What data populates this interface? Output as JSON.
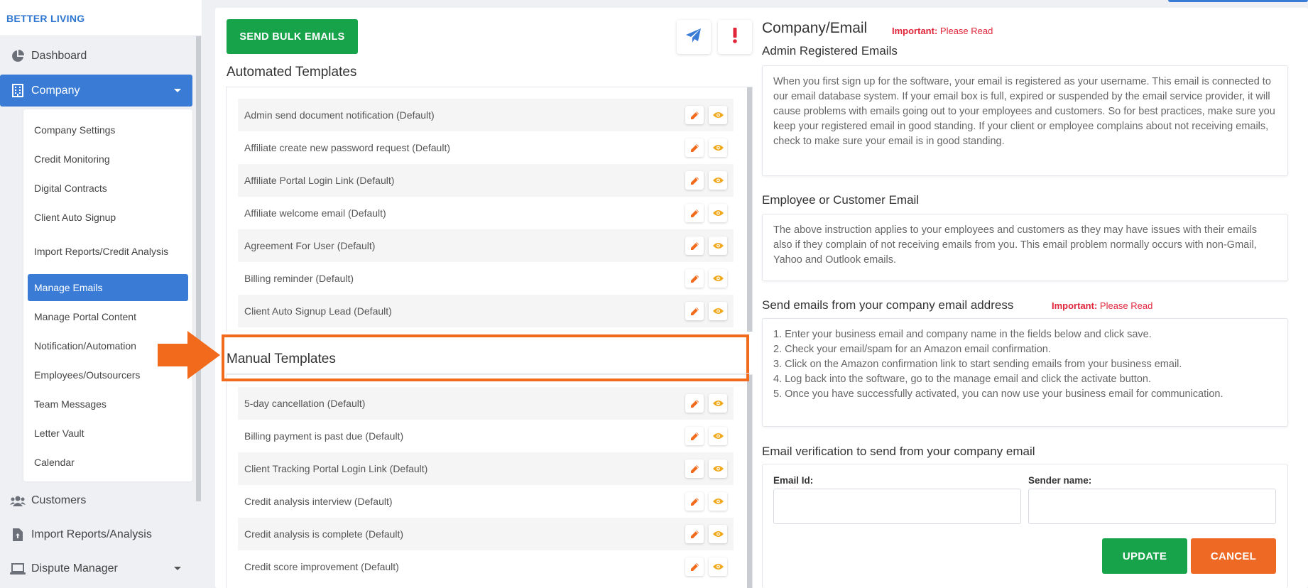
{
  "brand": {
    "name": "BETTER LIVING"
  },
  "sidebar": {
    "items": [
      {
        "label": "Dashboard",
        "icon": "pie-chart-icon"
      },
      {
        "label": "Company",
        "icon": "building-icon"
      },
      {
        "label": "Customers",
        "icon": "users-icon"
      },
      {
        "label": "Import Reports/Analysis",
        "icon": "file-upload-icon"
      },
      {
        "label": "Dispute Manager",
        "icon": "laptop-icon"
      }
    ],
    "company_submenu": [
      "Company Settings",
      "Credit Monitoring",
      "Digital Contracts",
      "Client Auto Signup",
      "Import Reports/Credit Analysis",
      "Manage Emails",
      "Manage Portal Content",
      "Notification/Automation",
      "Employees/Outsourcers",
      "Team Messages",
      "Letter Vault",
      "Calendar"
    ],
    "active_submenu": "Manage Emails"
  },
  "toolbar": {
    "bulk_label": "SEND BULK EMAILS",
    "send_icon": "paper-plane-icon",
    "alert_icon": "exclamation-icon"
  },
  "templates": {
    "automated_title": "Automated Templates",
    "automated": [
      "Admin send document notification (Default)",
      "Affiliate create new password request (Default)",
      "Affiliate Portal Login Link (Default)",
      "Affiliate welcome email (Default)",
      "Agreement For User (Default)",
      "Billing reminder (Default)",
      "Client Auto Signup Lead (Default)"
    ],
    "manual_title": "Manual Templates",
    "manual": [
      "5-day cancellation (Default)",
      "Billing payment is past due (Default)",
      "Client Tracking Portal Login Link (Default)",
      "Credit analysis interview (Default)",
      "Credit analysis is complete (Default)",
      "Credit score improvement (Default)"
    ]
  },
  "right": {
    "title": "Company/Email",
    "important_label": "Important:",
    "please_read": "Please Read",
    "admin_title": "Admin Registered Emails",
    "admin_text": "When you first sign up for the software, your email is registered as your username. This email is connected to our email database system. If your email box is full, expired or suspended by the email service provider, it will cause problems with emails going out to your employees and customers. So for best practices, make sure you keep your registered email in good standing. If your client or employee complains about not receiving emails, check to make sure your email is in good standing.",
    "employee_title": "Employee or Customer Email",
    "employee_text": "The above instruction applies to your employees and customers as they may have issues with their emails also if they complain of not receiving emails from you. This email problem normally occurs with non-Gmail, Yahoo and Outlook emails.",
    "send_title": "Send emails from your company email address",
    "steps": [
      "1. Enter your business email and company name in the fields below and click save.",
      "2. Check your email/spam for an Amazon email confirmation.",
      "3. Click on the Amazon confirmation link to start sending emails from your business email.",
      "4. Log back into the software, go to the manage email and click the activate button.",
      "5. Once you have successfully activated, you can now use your business email for communication."
    ],
    "verify_title": "Email verification to send from your company email",
    "email_label": "Email Id:",
    "sender_label": "Sender name:",
    "email_value": "",
    "sender_value": "",
    "update_label": "UPDATE",
    "cancel_label": "CANCEL"
  },
  "colors": {
    "primary": "#3a7bd5",
    "success": "#17a34a",
    "danger": "#e0263a",
    "orange": "#f26b1d"
  }
}
